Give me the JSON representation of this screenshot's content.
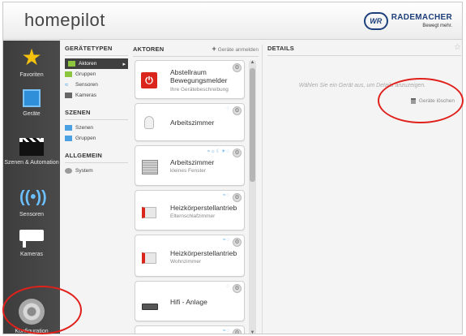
{
  "header": {
    "app_title": "homepilot",
    "brand_logo": "WR",
    "brand_name": "RADEMACHER",
    "brand_slogan": "Bewegt mehr."
  },
  "sidebar": {
    "items": [
      {
        "label": "Favoriten",
        "icon": "star-icon"
      },
      {
        "label": "Geräte",
        "icon": "devices-grid-icon"
      },
      {
        "label": "Szenen & Automation",
        "icon": "clapperboard-icon"
      },
      {
        "label": "Sensoren",
        "icon": "sensor-icon"
      },
      {
        "label": "Kameras",
        "icon": "camera-icon"
      },
      {
        "label": "Konfiguration",
        "icon": "gear-icon"
      }
    ]
  },
  "device_types": {
    "heading": "GERÄTETYPEN",
    "items": [
      {
        "label": "Aktoren",
        "active": true
      },
      {
        "label": "Gruppen"
      },
      {
        "label": "Sensoren"
      },
      {
        "label": "Kameras"
      }
    ]
  },
  "scenes": {
    "heading": "SZENEN",
    "items": [
      {
        "label": "Szenen"
      },
      {
        "label": "Gruppen"
      }
    ]
  },
  "general": {
    "heading": "ALLGEMEIN",
    "items": [
      {
        "label": "System"
      }
    ]
  },
  "actors": {
    "heading": "AKTOREN",
    "add_label": "Geräte anmelden",
    "add_symbol": "+",
    "devices": [
      {
        "name": "Abstellraum Bewegungsmelder",
        "description": "Ihre Gerätebeschreibung",
        "icon": "power-icon"
      },
      {
        "name": "Arbeitszimmer",
        "description": "",
        "icon": "bulb-icon"
      },
      {
        "name": "Arbeitszimmer",
        "description": "kleines Fenster",
        "icon": "shutter-icon"
      },
      {
        "name": "Heizkörperstellantrieb",
        "description": "Elternschlafzimmer",
        "icon": "heater-icon"
      },
      {
        "name": "Heizkörperstellantrieb",
        "description": "Wohnzimmer",
        "icon": "heater-icon"
      },
      {
        "name": "Hifi - Anlage",
        "description": "",
        "icon": "hifi-icon"
      }
    ]
  },
  "details": {
    "heading": "DETAILS",
    "message": "Wählen Sie ein Gerät aus, um Details anzuzeigen.",
    "delete_label": "Geräte löschen"
  },
  "colors": {
    "annotation": "#e0201b",
    "sidebar": "#444444",
    "favorite_star": "#f4c20d"
  }
}
